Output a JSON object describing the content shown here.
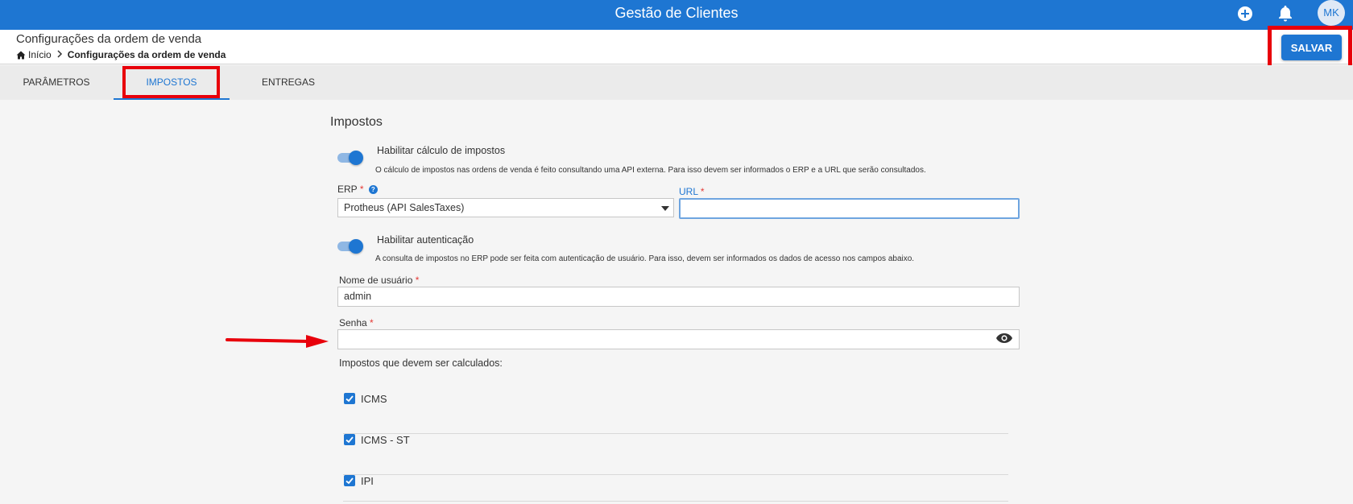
{
  "app": {
    "title": "Gestão de Clientes",
    "avatar_initials": "MK",
    "icons": {
      "add": "plus-circle-icon",
      "notifications": "bell-icon"
    },
    "accent_color": "#1e76d2"
  },
  "header": {
    "page_title": "Configurações da ordem de venda",
    "breadcrumb": {
      "home": "Início",
      "current": "Configurações da ordem de venda"
    },
    "save_label": "SALVAR"
  },
  "tabs": [
    {
      "label": "PARÂMETROS",
      "active": false
    },
    {
      "label": "IMPOSTOS",
      "active": true
    },
    {
      "label": "ENTREGAS",
      "active": false
    }
  ],
  "impostos": {
    "section_title": "Impostos",
    "tax_toggle": {
      "label": "Habilitar cálculo de impostos",
      "enabled": true,
      "help": "O cálculo de impostos nas ordens de venda é feito consultando uma API externa. Para isso devem ser informados o ERP e a URL que serão consultados."
    },
    "erp": {
      "label": "ERP",
      "required": "*",
      "value": "Protheus (API SalesTaxes)"
    },
    "url": {
      "label": "URL",
      "required": "*",
      "value": ""
    },
    "auth_toggle": {
      "label": "Habilitar autenticação",
      "enabled": true,
      "help": "A consulta de impostos no ERP pode ser feita com autenticação de usuário. Para isso, devem ser informados os dados de acesso nos campos abaixo."
    },
    "username": {
      "label": "Nome de usuário",
      "required": "*",
      "value": "admin"
    },
    "password": {
      "label": "Senha",
      "required": "*",
      "value": ""
    },
    "taxes_label": "Impostos que devem ser calculados:",
    "taxes": [
      {
        "label": "ICMS",
        "checked": true
      },
      {
        "label": "ICMS - ST",
        "checked": true
      },
      {
        "label": "IPI",
        "checked": true
      }
    ]
  },
  "annotations": {
    "highlight_color": "#e8000b"
  }
}
